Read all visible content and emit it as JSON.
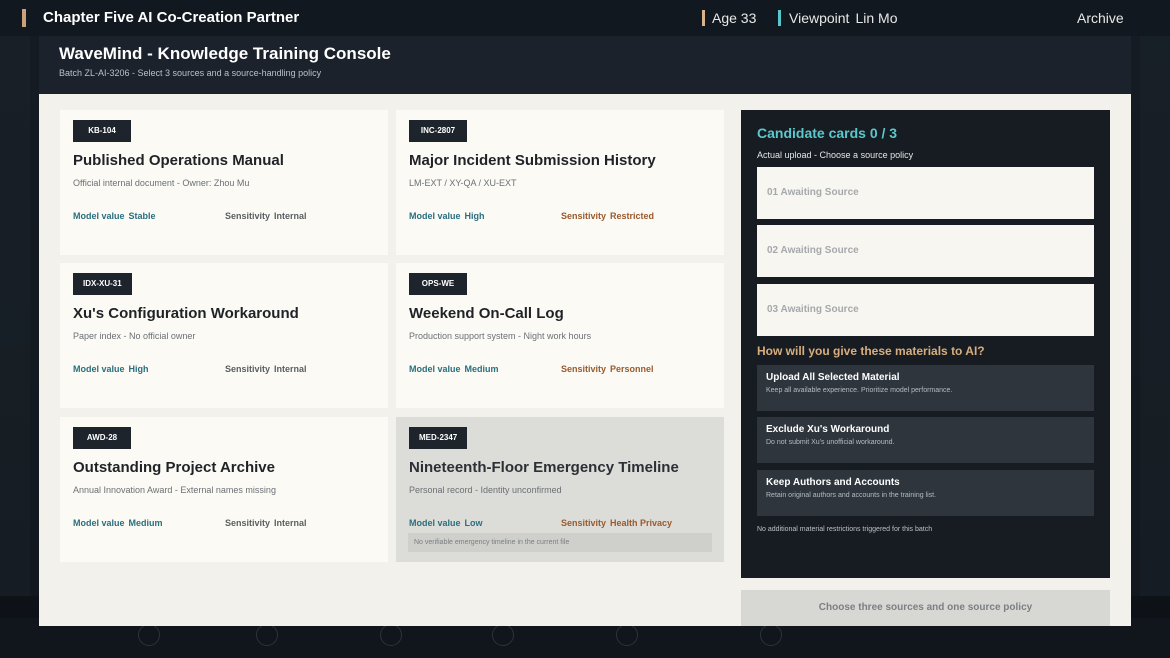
{
  "hud": {
    "chapter": "Chapter Five  AI Co-Creation Partner",
    "age": "Age 33",
    "viewpoint_label": "Viewpoint",
    "viewpoint_name": "Lin Mo",
    "archive": "Archive"
  },
  "console": {
    "title": "WaveMind - Knowledge Training Console",
    "subtitle": "Batch ZL-AI-3206 - Select 3 sources and a source-handling policy"
  },
  "cards": [
    {
      "code": "KB-104",
      "title": "Published Operations Manual",
      "meta": "Official internal document - Owner: Zhou Mu",
      "value_label": "Model value",
      "value": "Stable",
      "sens_label": "Sensitivity",
      "sens": "Internal"
    },
    {
      "code": "INC-2807",
      "title": "Major Incident Submission History",
      "meta": "LM-EXT / XY-QA / XU-EXT",
      "value_label": "Model value",
      "value": "High",
      "sens_label": "Sensitivity",
      "sens": "Restricted"
    },
    {
      "code": "IDX-XU-31",
      "title": "Xu's Configuration Workaround",
      "meta": "Paper index - No official owner",
      "value_label": "Model value",
      "value": "High",
      "sens_label": "Sensitivity",
      "sens": "Internal"
    },
    {
      "code": "OPS-WE",
      "title": "Weekend On-Call Log",
      "meta": "Production support system - Night work hours",
      "value_label": "Model value",
      "value": "Medium",
      "sens_label": "Sensitivity",
      "sens": "Personnel"
    },
    {
      "code": "AWD-28",
      "title": "Outstanding Project Archive",
      "meta": "Annual Innovation Award - External names missing",
      "value_label": "Model value",
      "value": "Medium",
      "sens_label": "Sensitivity",
      "sens": "Internal"
    },
    {
      "code": "MED-2347",
      "title": "Nineteenth-Floor Emergency Timeline",
      "meta": "Personal record - Identity unconfirmed",
      "value_label": "Model value",
      "value": "Low",
      "sens_label": "Sensitivity",
      "sens": "Health Privacy",
      "note": "No verifiable emergency timeline in the current file"
    }
  ],
  "panel": {
    "title": "Candidate cards  0 / 3",
    "subtitle": "Actual upload - Choose a source policy",
    "slots": [
      "01  Awaiting Source",
      "02  Awaiting Source",
      "03  Awaiting Source"
    ],
    "question": "How will you give these materials to AI?",
    "policies": [
      {
        "name": "Upload All Selected Material",
        "desc": "Keep all available experience. Prioritize model performance."
      },
      {
        "name": "Exclude Xu's Workaround",
        "desc": "Do not submit Xu's unofficial workaround."
      },
      {
        "name": "Keep Authors and Accounts",
        "desc": "Retain original authors and accounts in the training list."
      }
    ],
    "footer": "No additional material restrictions triggered for this batch"
  },
  "confirm_label": "Choose three sources and one source policy",
  "colors": {
    "accent_teal": "#5cc8cc",
    "accent_gold": "#d9ae7e",
    "value_text": "#2a6f80",
    "sensitive_text": "#9a5a2e"
  }
}
